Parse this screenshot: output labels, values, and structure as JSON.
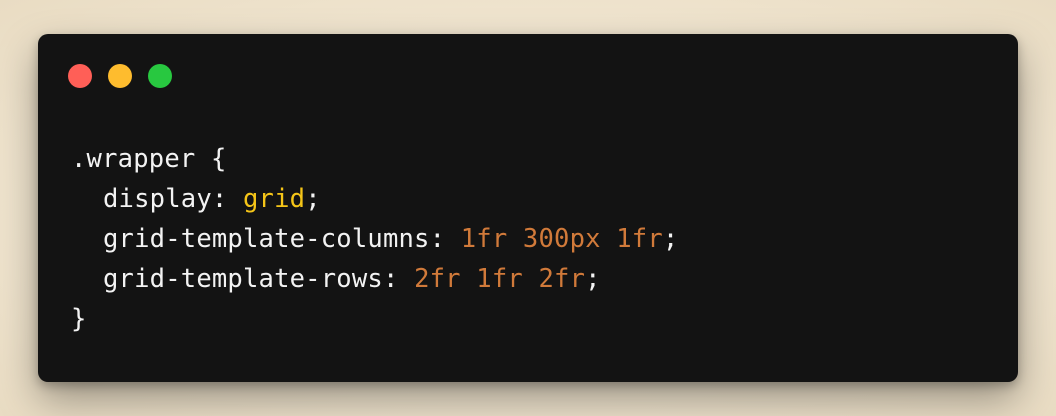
{
  "window": {
    "controls": [
      {
        "name": "close",
        "color": "#ff5f57"
      },
      {
        "name": "minimize",
        "color": "#febc2e"
      },
      {
        "name": "maximize",
        "color": "#28c840"
      }
    ]
  },
  "colors": {
    "text": "#f3f3f3",
    "keyword": "#f5c518",
    "number": "#d17a3a",
    "background": "#131313"
  },
  "code": {
    "line1": {
      "selector": ".wrapper",
      "brace": " {"
    },
    "line2": {
      "property": "display",
      "colon": ": ",
      "value": "grid",
      "semi": ";"
    },
    "line3": {
      "property": "grid-template-columns",
      "colon": ": ",
      "value": "1fr 300px 1fr",
      "semi": ";"
    },
    "line4": {
      "property": "grid-template-rows",
      "colon": ": ",
      "value": "2fr 1fr 2fr",
      "semi": ";"
    },
    "line5": {
      "brace": "}"
    }
  }
}
